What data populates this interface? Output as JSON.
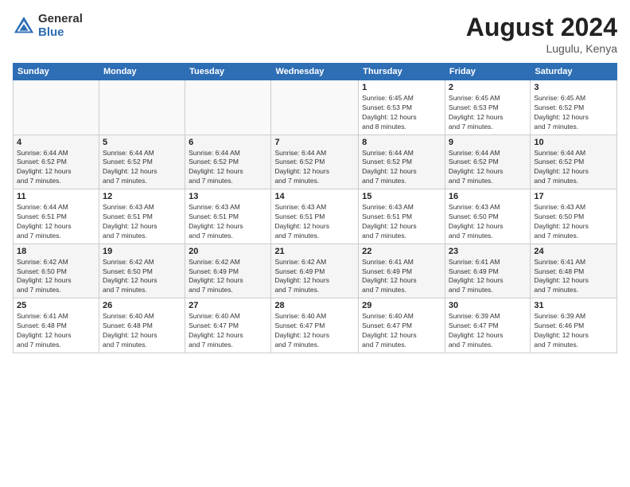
{
  "logo": {
    "general": "General",
    "blue": "Blue"
  },
  "title": "August 2024",
  "location": "Lugulu, Kenya",
  "days_of_week": [
    "Sunday",
    "Monday",
    "Tuesday",
    "Wednesday",
    "Thursday",
    "Friday",
    "Saturday"
  ],
  "weeks": [
    [
      {
        "day": "",
        "info": ""
      },
      {
        "day": "",
        "info": ""
      },
      {
        "day": "",
        "info": ""
      },
      {
        "day": "",
        "info": ""
      },
      {
        "day": "1",
        "info": "Sunrise: 6:45 AM\nSunset: 6:53 PM\nDaylight: 12 hours\nand 8 minutes."
      },
      {
        "day": "2",
        "info": "Sunrise: 6:45 AM\nSunset: 6:53 PM\nDaylight: 12 hours\nand 7 minutes."
      },
      {
        "day": "3",
        "info": "Sunrise: 6:45 AM\nSunset: 6:52 PM\nDaylight: 12 hours\nand 7 minutes."
      }
    ],
    [
      {
        "day": "4",
        "info": "Sunrise: 6:44 AM\nSunset: 6:52 PM\nDaylight: 12 hours\nand 7 minutes."
      },
      {
        "day": "5",
        "info": "Sunrise: 6:44 AM\nSunset: 6:52 PM\nDaylight: 12 hours\nand 7 minutes."
      },
      {
        "day": "6",
        "info": "Sunrise: 6:44 AM\nSunset: 6:52 PM\nDaylight: 12 hours\nand 7 minutes."
      },
      {
        "day": "7",
        "info": "Sunrise: 6:44 AM\nSunset: 6:52 PM\nDaylight: 12 hours\nand 7 minutes."
      },
      {
        "day": "8",
        "info": "Sunrise: 6:44 AM\nSunset: 6:52 PM\nDaylight: 12 hours\nand 7 minutes."
      },
      {
        "day": "9",
        "info": "Sunrise: 6:44 AM\nSunset: 6:52 PM\nDaylight: 12 hours\nand 7 minutes."
      },
      {
        "day": "10",
        "info": "Sunrise: 6:44 AM\nSunset: 6:52 PM\nDaylight: 12 hours\nand 7 minutes."
      }
    ],
    [
      {
        "day": "11",
        "info": "Sunrise: 6:44 AM\nSunset: 6:51 PM\nDaylight: 12 hours\nand 7 minutes."
      },
      {
        "day": "12",
        "info": "Sunrise: 6:43 AM\nSunset: 6:51 PM\nDaylight: 12 hours\nand 7 minutes."
      },
      {
        "day": "13",
        "info": "Sunrise: 6:43 AM\nSunset: 6:51 PM\nDaylight: 12 hours\nand 7 minutes."
      },
      {
        "day": "14",
        "info": "Sunrise: 6:43 AM\nSunset: 6:51 PM\nDaylight: 12 hours\nand 7 minutes."
      },
      {
        "day": "15",
        "info": "Sunrise: 6:43 AM\nSunset: 6:51 PM\nDaylight: 12 hours\nand 7 minutes."
      },
      {
        "day": "16",
        "info": "Sunrise: 6:43 AM\nSunset: 6:50 PM\nDaylight: 12 hours\nand 7 minutes."
      },
      {
        "day": "17",
        "info": "Sunrise: 6:43 AM\nSunset: 6:50 PM\nDaylight: 12 hours\nand 7 minutes."
      }
    ],
    [
      {
        "day": "18",
        "info": "Sunrise: 6:42 AM\nSunset: 6:50 PM\nDaylight: 12 hours\nand 7 minutes."
      },
      {
        "day": "19",
        "info": "Sunrise: 6:42 AM\nSunset: 6:50 PM\nDaylight: 12 hours\nand 7 minutes."
      },
      {
        "day": "20",
        "info": "Sunrise: 6:42 AM\nSunset: 6:49 PM\nDaylight: 12 hours\nand 7 minutes."
      },
      {
        "day": "21",
        "info": "Sunrise: 6:42 AM\nSunset: 6:49 PM\nDaylight: 12 hours\nand 7 minutes."
      },
      {
        "day": "22",
        "info": "Sunrise: 6:41 AM\nSunset: 6:49 PM\nDaylight: 12 hours\nand 7 minutes."
      },
      {
        "day": "23",
        "info": "Sunrise: 6:41 AM\nSunset: 6:49 PM\nDaylight: 12 hours\nand 7 minutes."
      },
      {
        "day": "24",
        "info": "Sunrise: 6:41 AM\nSunset: 6:48 PM\nDaylight: 12 hours\nand 7 minutes."
      }
    ],
    [
      {
        "day": "25",
        "info": "Sunrise: 6:41 AM\nSunset: 6:48 PM\nDaylight: 12 hours\nand 7 minutes."
      },
      {
        "day": "26",
        "info": "Sunrise: 6:40 AM\nSunset: 6:48 PM\nDaylight: 12 hours\nand 7 minutes."
      },
      {
        "day": "27",
        "info": "Sunrise: 6:40 AM\nSunset: 6:47 PM\nDaylight: 12 hours\nand 7 minutes."
      },
      {
        "day": "28",
        "info": "Sunrise: 6:40 AM\nSunset: 6:47 PM\nDaylight: 12 hours\nand 7 minutes."
      },
      {
        "day": "29",
        "info": "Sunrise: 6:40 AM\nSunset: 6:47 PM\nDaylight: 12 hours\nand 7 minutes."
      },
      {
        "day": "30",
        "info": "Sunrise: 6:39 AM\nSunset: 6:47 PM\nDaylight: 12 hours\nand 7 minutes."
      },
      {
        "day": "31",
        "info": "Sunrise: 6:39 AM\nSunset: 6:46 PM\nDaylight: 12 hours\nand 7 minutes."
      }
    ]
  ]
}
